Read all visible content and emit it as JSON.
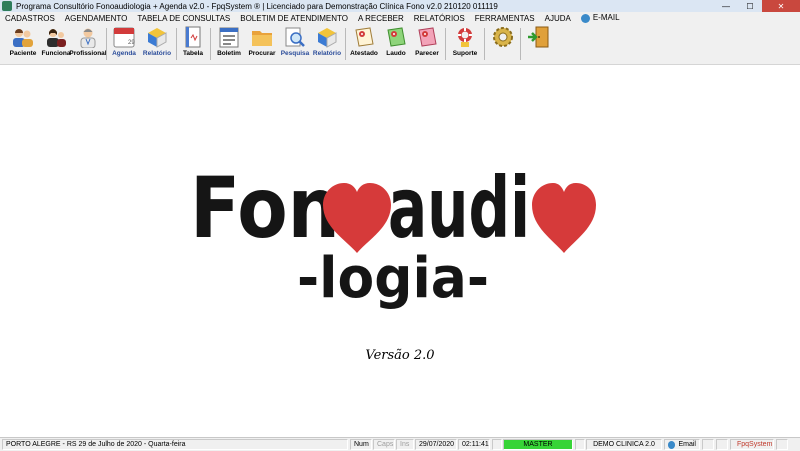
{
  "window": {
    "title": "Programa Consultório Fonoaudiologia + Agenda v2.0 - FpqSystem ® | Licenciado para  Demonstração Clínica Fono v2.0 210120 011119",
    "minimize": "—",
    "maximize": "☐",
    "close": "✕"
  },
  "menu": {
    "items": [
      "CADASTROS",
      "AGENDAMENTO",
      "TABELA DE CONSULTAS",
      "BOLETIM DE ATENDIMENTO",
      "A RECEBER",
      "RELATÓRIOS",
      "FERRAMENTAS",
      "AJUDA"
    ],
    "email": "E-MAIL"
  },
  "toolbar": {
    "paciente": "Paciente",
    "funciona": "Funciona",
    "profissional": "Profissional",
    "agenda": "Agenda",
    "relatorio1": "Relatório",
    "tabela": "Tabela",
    "boletim": "Boletim",
    "procurar": "Procurar",
    "pesquisa": "Pesquisa",
    "relatorio2": "Relatório",
    "atestado": "Atestado",
    "laudo": "Laudo",
    "parecer": "Parecer",
    "suporte": "Suporte",
    "calendar_day": "29"
  },
  "splash": {
    "logo_word1_a": "Fon",
    "logo_word1_b": "audi",
    "logo_word2": "-logia-",
    "version": "Versão 2.0"
  },
  "statusbar": {
    "location_date": "PORTO ALEGRE - RS 29 de Julho de 2020 - Quarta-feira",
    "num": "Num",
    "caps": "Caps",
    "ins": "Ins",
    "date": "29/07/2020",
    "time": "02:11:41",
    "user": "MASTER",
    "company": "DEMO CLINICA 2.0",
    "email": "Email",
    "brand": "FpqSystem"
  },
  "colors": {
    "heart": "#d63a3a",
    "status_green": "#37d437",
    "brand_red": "#c0392b",
    "titlebar": "#dbe6f3"
  }
}
